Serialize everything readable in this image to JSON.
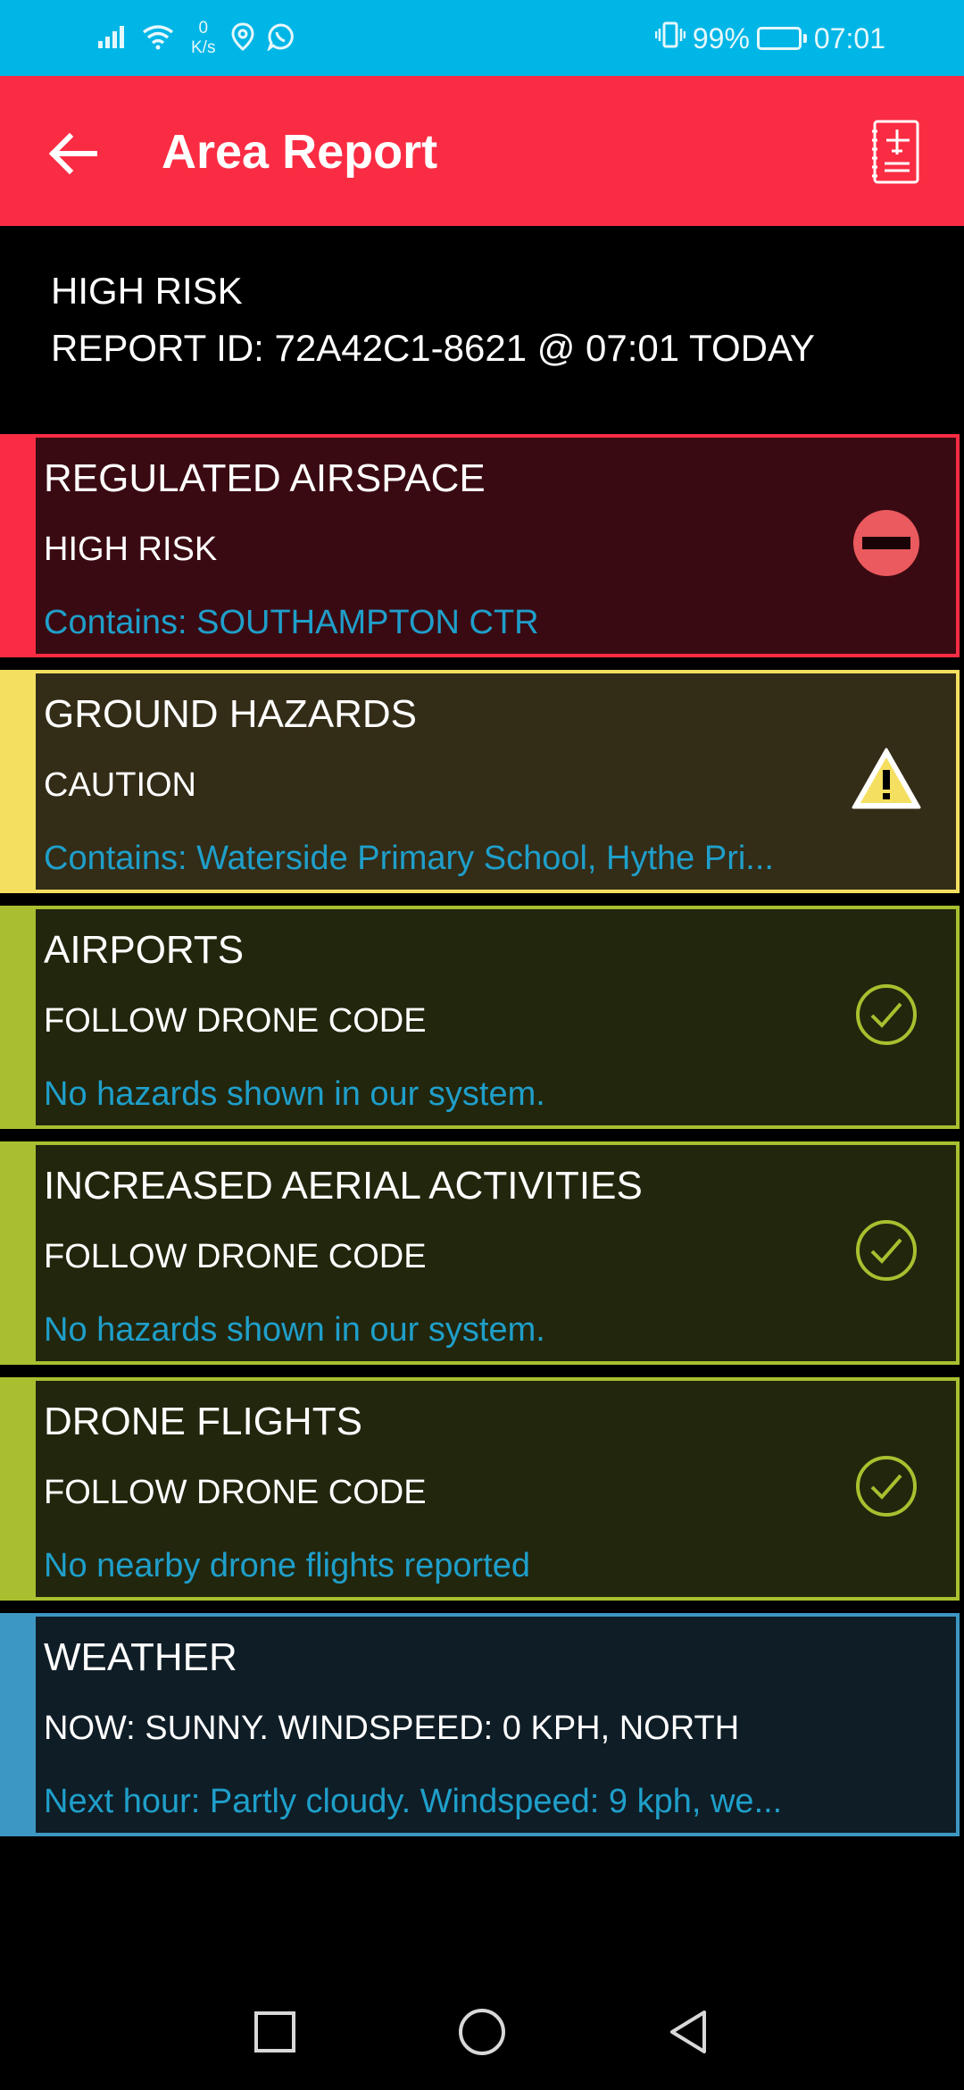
{
  "status_bar": {
    "net_speed_value": "0",
    "net_speed_unit": "K/s",
    "battery": "99%",
    "time": "07:01"
  },
  "app_bar": {
    "title": "Area Report"
  },
  "summary": {
    "risk": "HIGH RISK",
    "report_id": "REPORT ID: 72A42C1-8621 @ 07:01 TODAY"
  },
  "cards": [
    {
      "title": "REGULATED AIRSPACE",
      "status": "HIGH RISK",
      "detail": "Contains: SOUTHAMPTON CTR",
      "icon": "no-entry-icon",
      "strip_color": "#fa2c43",
      "bg_color": "#3a0a12",
      "border_color": "#fa2c43"
    },
    {
      "title": "GROUND HAZARDS",
      "status": "CAUTION",
      "detail": "Contains: Waterside Primary School, Hythe Pri...",
      "icon": "warning-icon",
      "strip_color": "#f5df60",
      "bg_color": "#332c17",
      "border_color": "#f5df60"
    },
    {
      "title": "AIRPORTS",
      "status": "FOLLOW DRONE CODE",
      "detail": "No hazards shown in our system.",
      "icon": "check-circle-icon",
      "strip_color": "#a9bf2f",
      "bg_color": "#22260d",
      "border_color": "#a9bf2f"
    },
    {
      "title": "INCREASED AERIAL ACTIVITIES",
      "status": "FOLLOW DRONE CODE",
      "detail": "No hazards shown in our system.",
      "icon": "check-circle-icon",
      "strip_color": "#a9bf2f",
      "bg_color": "#22260d",
      "border_color": "#a9bf2f"
    },
    {
      "title": "DRONE FLIGHTS",
      "status": "FOLLOW DRONE CODE",
      "detail": "No nearby drone flights reported",
      "icon": "check-circle-icon",
      "strip_color": "#a9bf2f",
      "bg_color": "#22260d",
      "border_color": "#a9bf2f"
    },
    {
      "title": "WEATHER",
      "status": "NOW: SUNNY. WINDSPEED: 0 KPH, NORTH",
      "detail": "Next hour: Partly cloudy. Windspeed: 9 kph, we...",
      "icon": "",
      "strip_color": "#3d97c4",
      "bg_color": "#0f1d26",
      "border_color": "#3d97c4"
    }
  ]
}
